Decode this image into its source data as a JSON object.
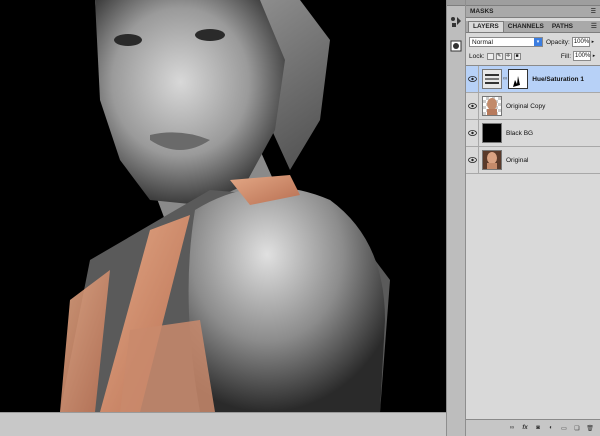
{
  "panel": {
    "masks_tab": "MASKS",
    "tabs": [
      "LAYERS",
      "CHANNELS",
      "PATHS"
    ],
    "blend_mode": "Normal",
    "opacity_label": "Opacity:",
    "opacity_value": "100%",
    "lock_label": "Lock:",
    "fill_label": "Fill:",
    "fill_value": "100%",
    "layers": [
      {
        "name": "Hue/Saturation 1",
        "selected": true
      },
      {
        "name": "Original Copy",
        "selected": false
      },
      {
        "name": "Black BG",
        "selected": false
      },
      {
        "name": "Original",
        "selected": false
      }
    ]
  },
  "icons": {
    "eye": "eye-icon",
    "adjustment": "adjustment-layer-icon",
    "link": "link-icon",
    "fx": "fx-icon",
    "mask": "add-mask-icon",
    "new_fill": "new-fill-adjustment-icon",
    "group": "folder-icon",
    "new_layer": "new-layer-icon",
    "trash": "trash-icon"
  },
  "colors": {
    "selection": "#b7d1f7",
    "accent": "#3b7de0",
    "shirt": "#d8957a"
  }
}
